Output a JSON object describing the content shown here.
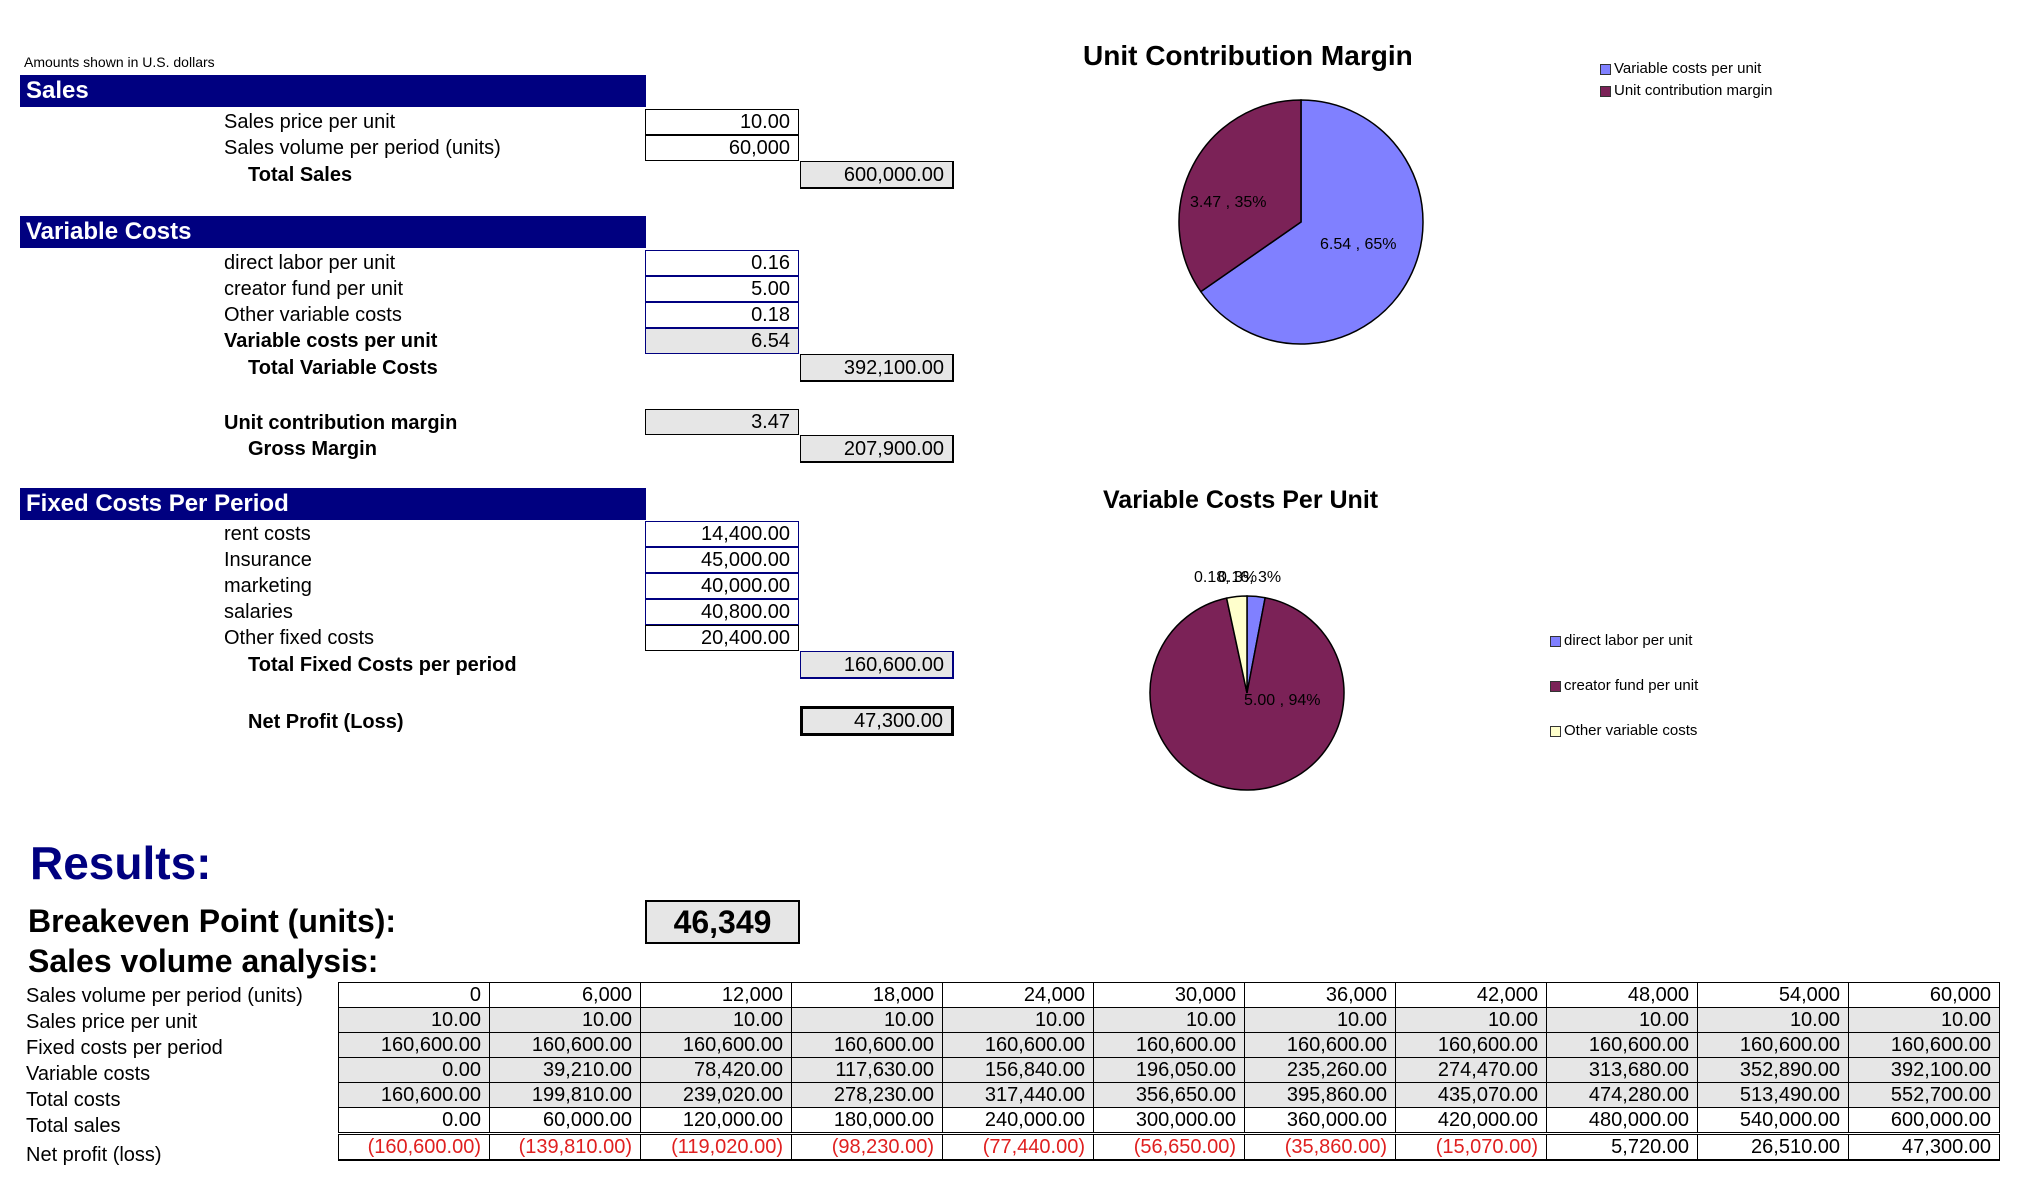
{
  "note": "Amounts shown in U.S. dollars",
  "sales": {
    "header": "Sales",
    "price_label": "Sales price per unit",
    "price": "10.00",
    "volume_label": "Sales volume per period (units)",
    "volume": "60,000",
    "total_label": "Total Sales",
    "total": "600,000.00"
  },
  "variable": {
    "header": "Variable Costs",
    "items": [
      {
        "label": "direct labor per unit",
        "value": "0.16"
      },
      {
        "label": "creator fund per unit",
        "value": "5.00"
      },
      {
        "label": "Other variable costs",
        "value": "0.18"
      }
    ],
    "per_unit_label": "Variable costs per unit",
    "per_unit": "6.54",
    "total_label": "Total Variable Costs",
    "total": "392,100.00"
  },
  "margin": {
    "ucm_label": "Unit contribution margin",
    "ucm": "3.47",
    "gross_label": "Gross Margin",
    "gross": "207,900.00"
  },
  "fixed": {
    "header": "Fixed Costs Per Period",
    "items": [
      {
        "label": "rent costs",
        "value": "14,400.00"
      },
      {
        "label": "Insurance",
        "value": "45,000.00"
      },
      {
        "label": "marketing",
        "value": "40,000.00"
      },
      {
        "label": "salaries",
        "value": "40,800.00"
      },
      {
        "label": "Other fixed costs",
        "value": "20,400.00"
      }
    ],
    "total_label": "Total Fixed Costs per period",
    "total": "160,600.00"
  },
  "net": {
    "label": "Net Profit (Loss)",
    "value": "47,300.00"
  },
  "results": {
    "title": "Results:",
    "breakeven_label": "Breakeven Point (units):",
    "breakeven": "46,349",
    "analysis_label": "Sales volume analysis:"
  },
  "analysis": {
    "rows": [
      {
        "label": "Sales volume per period (units)",
        "values": [
          "0",
          "6,000",
          "12,000",
          "18,000",
          "24,000",
          "30,000",
          "36,000",
          "42,000",
          "48,000",
          "54,000",
          "60,000"
        ]
      },
      {
        "label": "Sales price per unit",
        "values": [
          "10.00",
          "10.00",
          "10.00",
          "10.00",
          "10.00",
          "10.00",
          "10.00",
          "10.00",
          "10.00",
          "10.00",
          "10.00"
        ]
      },
      {
        "label": "Fixed costs per period",
        "values": [
          "160,600.00",
          "160,600.00",
          "160,600.00",
          "160,600.00",
          "160,600.00",
          "160,600.00",
          "160,600.00",
          "160,600.00",
          "160,600.00",
          "160,600.00",
          "160,600.00"
        ]
      },
      {
        "label": "Variable costs",
        "values": [
          "0.00",
          "39,210.00",
          "78,420.00",
          "117,630.00",
          "156,840.00",
          "196,050.00",
          "235,260.00",
          "274,470.00",
          "313,680.00",
          "352,890.00",
          "392,100.00"
        ]
      },
      {
        "label": "Total costs",
        "values": [
          "160,600.00",
          "199,810.00",
          "239,020.00",
          "278,230.00",
          "317,440.00",
          "356,650.00",
          "395,860.00",
          "435,070.00",
          "474,280.00",
          "513,490.00",
          "552,700.00"
        ]
      },
      {
        "label": "Total sales",
        "values": [
          "0.00",
          "60,000.00",
          "120,000.00",
          "180,000.00",
          "240,000.00",
          "300,000.00",
          "360,000.00",
          "420,000.00",
          "480,000.00",
          "540,000.00",
          "600,000.00"
        ]
      },
      {
        "label": "Net profit (loss)",
        "values": [
          "(160,600.00)",
          "(139,810.00)",
          "(119,020.00)",
          "(98,230.00)",
          "(77,440.00)",
          "(56,650.00)",
          "(35,860.00)",
          "(15,070.00)",
          "5,720.00",
          "26,510.00",
          "47,300.00"
        ]
      }
    ]
  },
  "colors": {
    "header_bg": "#000080",
    "negative": "#e02020",
    "grey_cell": "#e6e6e6"
  },
  "chart_data": [
    {
      "type": "pie",
      "title": "Unit Contribution Margin",
      "categories": [
        "Variable costs per unit",
        "Unit contribution margin"
      ],
      "values": [
        6.54,
        3.47
      ],
      "labels": [
        "6.54 , 65%",
        "3.47 , 35%"
      ],
      "colors": [
        "#8080ff",
        "#7b2257"
      ],
      "legend_position": "top-right"
    },
    {
      "type": "pie",
      "title": "Variable Costs Per Unit",
      "categories": [
        "direct labor per unit",
        "creator fund per unit",
        "Other variable costs"
      ],
      "values": [
        0.16,
        5.0,
        0.18
      ],
      "labels": [
        "0.18, 3%",
        "5.00 , 94%",
        "0.16, 3%"
      ],
      "colors": [
        "#8080ff",
        "#7b2257",
        "#ffffcc"
      ],
      "legend_position": "right"
    }
  ]
}
